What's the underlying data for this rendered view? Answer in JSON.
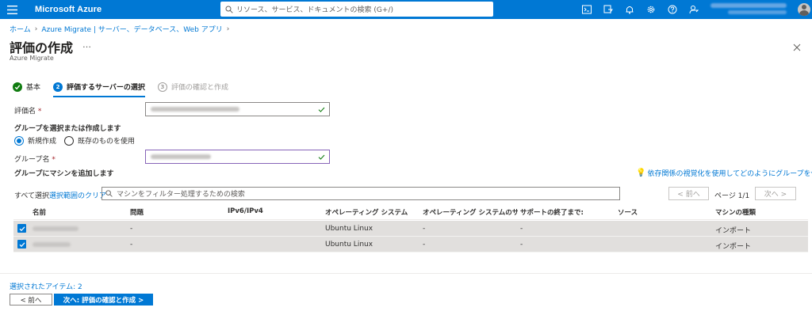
{
  "topbar": {
    "brand": "Microsoft Azure",
    "search_placeholder": "リソース、サービス、ドキュメントの検索 (G+/)",
    "icons": [
      "cloud-shell-icon",
      "directory-filter-icon",
      "bell-icon",
      "gear-icon",
      "help-icon",
      "feedback-icon"
    ],
    "accent": "#0078d4"
  },
  "breadcrumb": {
    "home": "ホーム",
    "item2": "Azure Migrate | サーバー、データベース、Web アプリ"
  },
  "page": {
    "title": "評価の作成",
    "more": "…",
    "subtitle": "Azure Migrate"
  },
  "steps": [
    {
      "number": "",
      "label": "基本",
      "state": "done"
    },
    {
      "number": "2",
      "label": "評価するサーバーの選択",
      "state": "active"
    },
    {
      "number": "3",
      "label": "評価の確認と作成",
      "state": "future"
    }
  ],
  "form": {
    "assessment_name_label": "評価名",
    "required_mark": "*",
    "group_section_heading": "グループを選択または作成します",
    "radio_new": "新規作成",
    "radio_existing": "既存のものを使用",
    "group_name_label": "グループ名",
    "add_machines_heading": "グループにマシンを追加します",
    "help_link": "依存関係の視覚化を使用してどのようにグループを作成するか"
  },
  "toolbar": {
    "select_all": "すべて選択",
    "clear_selection": "選択範囲のクリア",
    "filter_placeholder": "マシンをフィルター処理するための検索",
    "prev_page": "< 前へ",
    "page_info": "ページ 1/1",
    "next_page": "次へ >"
  },
  "table": {
    "columns": [
      "名前",
      "問題",
      "IPv6/IPv4",
      "オペレーティング システム",
      "オペレーティング システムのサポ…",
      "サポートの終了まで:",
      "ソース",
      "マシンの種類"
    ],
    "rows": [
      {
        "issues": "-",
        "ip": "",
        "os": "Ubuntu Linux",
        "os_support": "-",
        "eos": "-",
        "source": "",
        "type": "インポート"
      },
      {
        "issues": "-",
        "ip": "",
        "os": "Ubuntu Linux",
        "os_support": "-",
        "eos": "-",
        "source": "",
        "type": "インポート"
      }
    ]
  },
  "footer": {
    "selected_items": "選択されたアイテム: 2",
    "prev_button": "< 前へ",
    "next_button": "次へ: 評価の確認と作成 >"
  }
}
